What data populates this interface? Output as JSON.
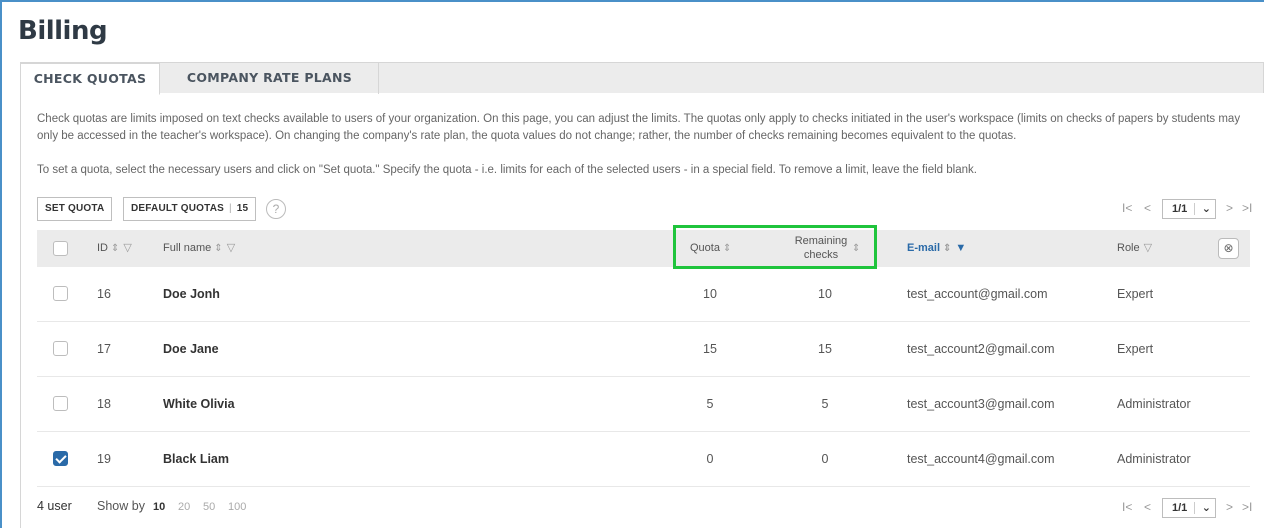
{
  "page": {
    "title": "Billing",
    "tabs": [
      "CHECK QUOTAS",
      "COMPANY RATE PLANS"
    ],
    "description_1": "Check quotas are limits imposed on text checks available to users of your organization. On this page, you can adjust the limits. The quotas only apply to checks initiated in the user's workspace (limits on checks of papers by students may only be accessed in the teacher's workspace). On changing the company's rate plan, the quota values do not change; rather, the number of checks remaining becomes equivalent to the quotas.",
    "description_2": "To set a quota, select the necessary users and click on \"Set quota.\" Specify the quota - i.e. limits for each of the selected users - in a special field. To remove a limit, leave the field blank."
  },
  "toolbar": {
    "set_quota": "SET QUOTA",
    "default_quotas": "DEFAULT QUOTAS",
    "default_quotas_value": "15",
    "help": "?"
  },
  "pager": {
    "first": "I<",
    "prev": "<",
    "next": ">",
    "last": ">I",
    "page": "1/1",
    "dropdown": "⌄"
  },
  "table": {
    "headers": {
      "id": "ID",
      "full_name": "Full name",
      "quota": "Quota",
      "remaining_1": "Remaining",
      "remaining_2": "checks",
      "email": "E-mail",
      "role": "Role"
    },
    "rows": [
      {
        "checked": false,
        "id": "16",
        "name": "Doe Jonh",
        "quota": "10",
        "remaining": "10",
        "email": "test_account@gmail.com",
        "role": "Expert"
      },
      {
        "checked": false,
        "id": "17",
        "name": "Doe Jane",
        "quota": "15",
        "remaining": "15",
        "email": "test_account2@gmail.com",
        "role": "Expert"
      },
      {
        "checked": false,
        "id": "18",
        "name": "White Olivia",
        "quota": "5",
        "remaining": "5",
        "email": "test_account3@gmail.com",
        "role": "Administrator"
      },
      {
        "checked": true,
        "id": "19",
        "name": "Black Liam",
        "quota": "0",
        "remaining": "0",
        "email": "test_account4@gmail.com",
        "role": "Administrator"
      }
    ]
  },
  "footer": {
    "count": "4 user",
    "show_by": "Show by",
    "options": [
      "10",
      "20",
      "50",
      "100"
    ],
    "selected": "10"
  },
  "colors": {
    "accent": "#2a6aa8",
    "highlight": "#1fc43c",
    "header_bg": "#ebebeb"
  }
}
